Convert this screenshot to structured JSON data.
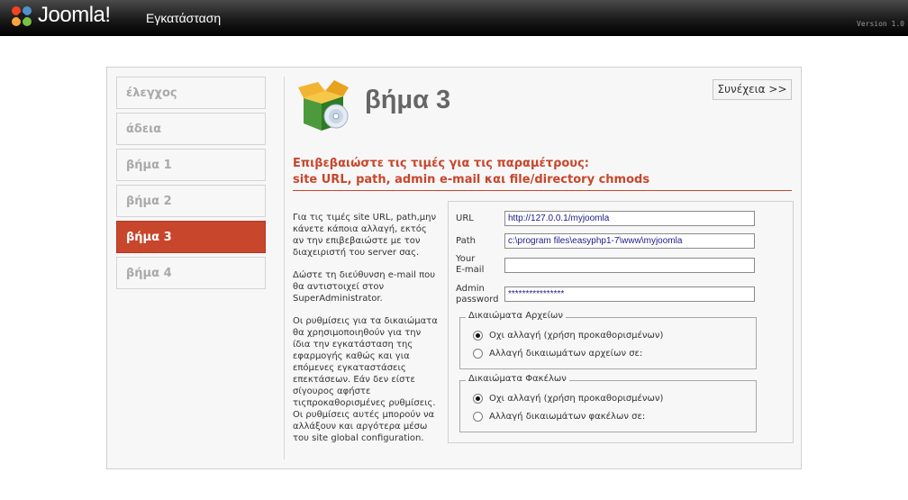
{
  "header": {
    "brand": "Joomla!",
    "subtitle": "Εγκατάσταση",
    "version": "Version 1.0"
  },
  "steps": [
    {
      "label": "έλεγχος",
      "active": false
    },
    {
      "label": "άδεια",
      "active": false
    },
    {
      "label": "βήμα 1",
      "active": false
    },
    {
      "label": "βήμα 2",
      "active": false
    },
    {
      "label": "βήμα 3",
      "active": true
    },
    {
      "label": "βήμα 4",
      "active": false
    }
  ],
  "page": {
    "title": "βήμα 3",
    "continue_label": "Συνέχεια >>",
    "heading_line1": "Επιβεβαιώστε τις τιμές για τις παραμέτρους:",
    "heading_line2": "site URL, path, admin e-mail και file/directory chmods"
  },
  "description": {
    "p1": "Για τις τιμές site URL, path,μην κάνετε κάποια αλλαγή, εκτός αν την επιβεβαιώστε με τον διαχειριστή του server σας.",
    "p2": "Δώστε τη διεύθυνση e-mail που θα αντιστοιχεί στον SuperAdministrator.",
    "p3": "Οι ρυθμίσεις για τα δικαιώματα θα χρησιμοποιηθούν για την ίδια την εγκατάσταση της εφαρμογής καθώς και για επόμενες εγκαταστάσεις επεκτάσεων. Εάν δεν είστε σίγουρος αφήστε τιςπροκαθορισμένες ρυθμίσεις. Οι ρυθμίσεις αυτές μπορούν να αλλάξουν και αργότερα μέσω του site global configuration."
  },
  "form": {
    "url_label": "URL",
    "url_value": "http://127.0.0.1/myjoomla",
    "path_label": "Path",
    "path_value": "c:\\program files\\easyphp1-7\\www\\myjoomla",
    "email_label_1": "Your",
    "email_label_2": "E-mail",
    "email_value": "",
    "password_label_1": "Admin",
    "password_label_2": "password",
    "password_value": "****************",
    "file_perms": {
      "legend": "Δικαιώματα Αρχείων",
      "opt1": "Οχι αλλαγή (χρήση προκαθορισμένων)",
      "opt2": "Αλλαγή δικαιωμάτων αρχείων σε:",
      "selected": 1
    },
    "dir_perms": {
      "legend": "Δικαιώματα Φακέλων",
      "opt1": "Οχι αλλαγή (χρήση προκαθορισμένων)",
      "opt2": "Αλλαγή δικαιωμάτων φακέλων σε:",
      "selected": 1
    }
  }
}
